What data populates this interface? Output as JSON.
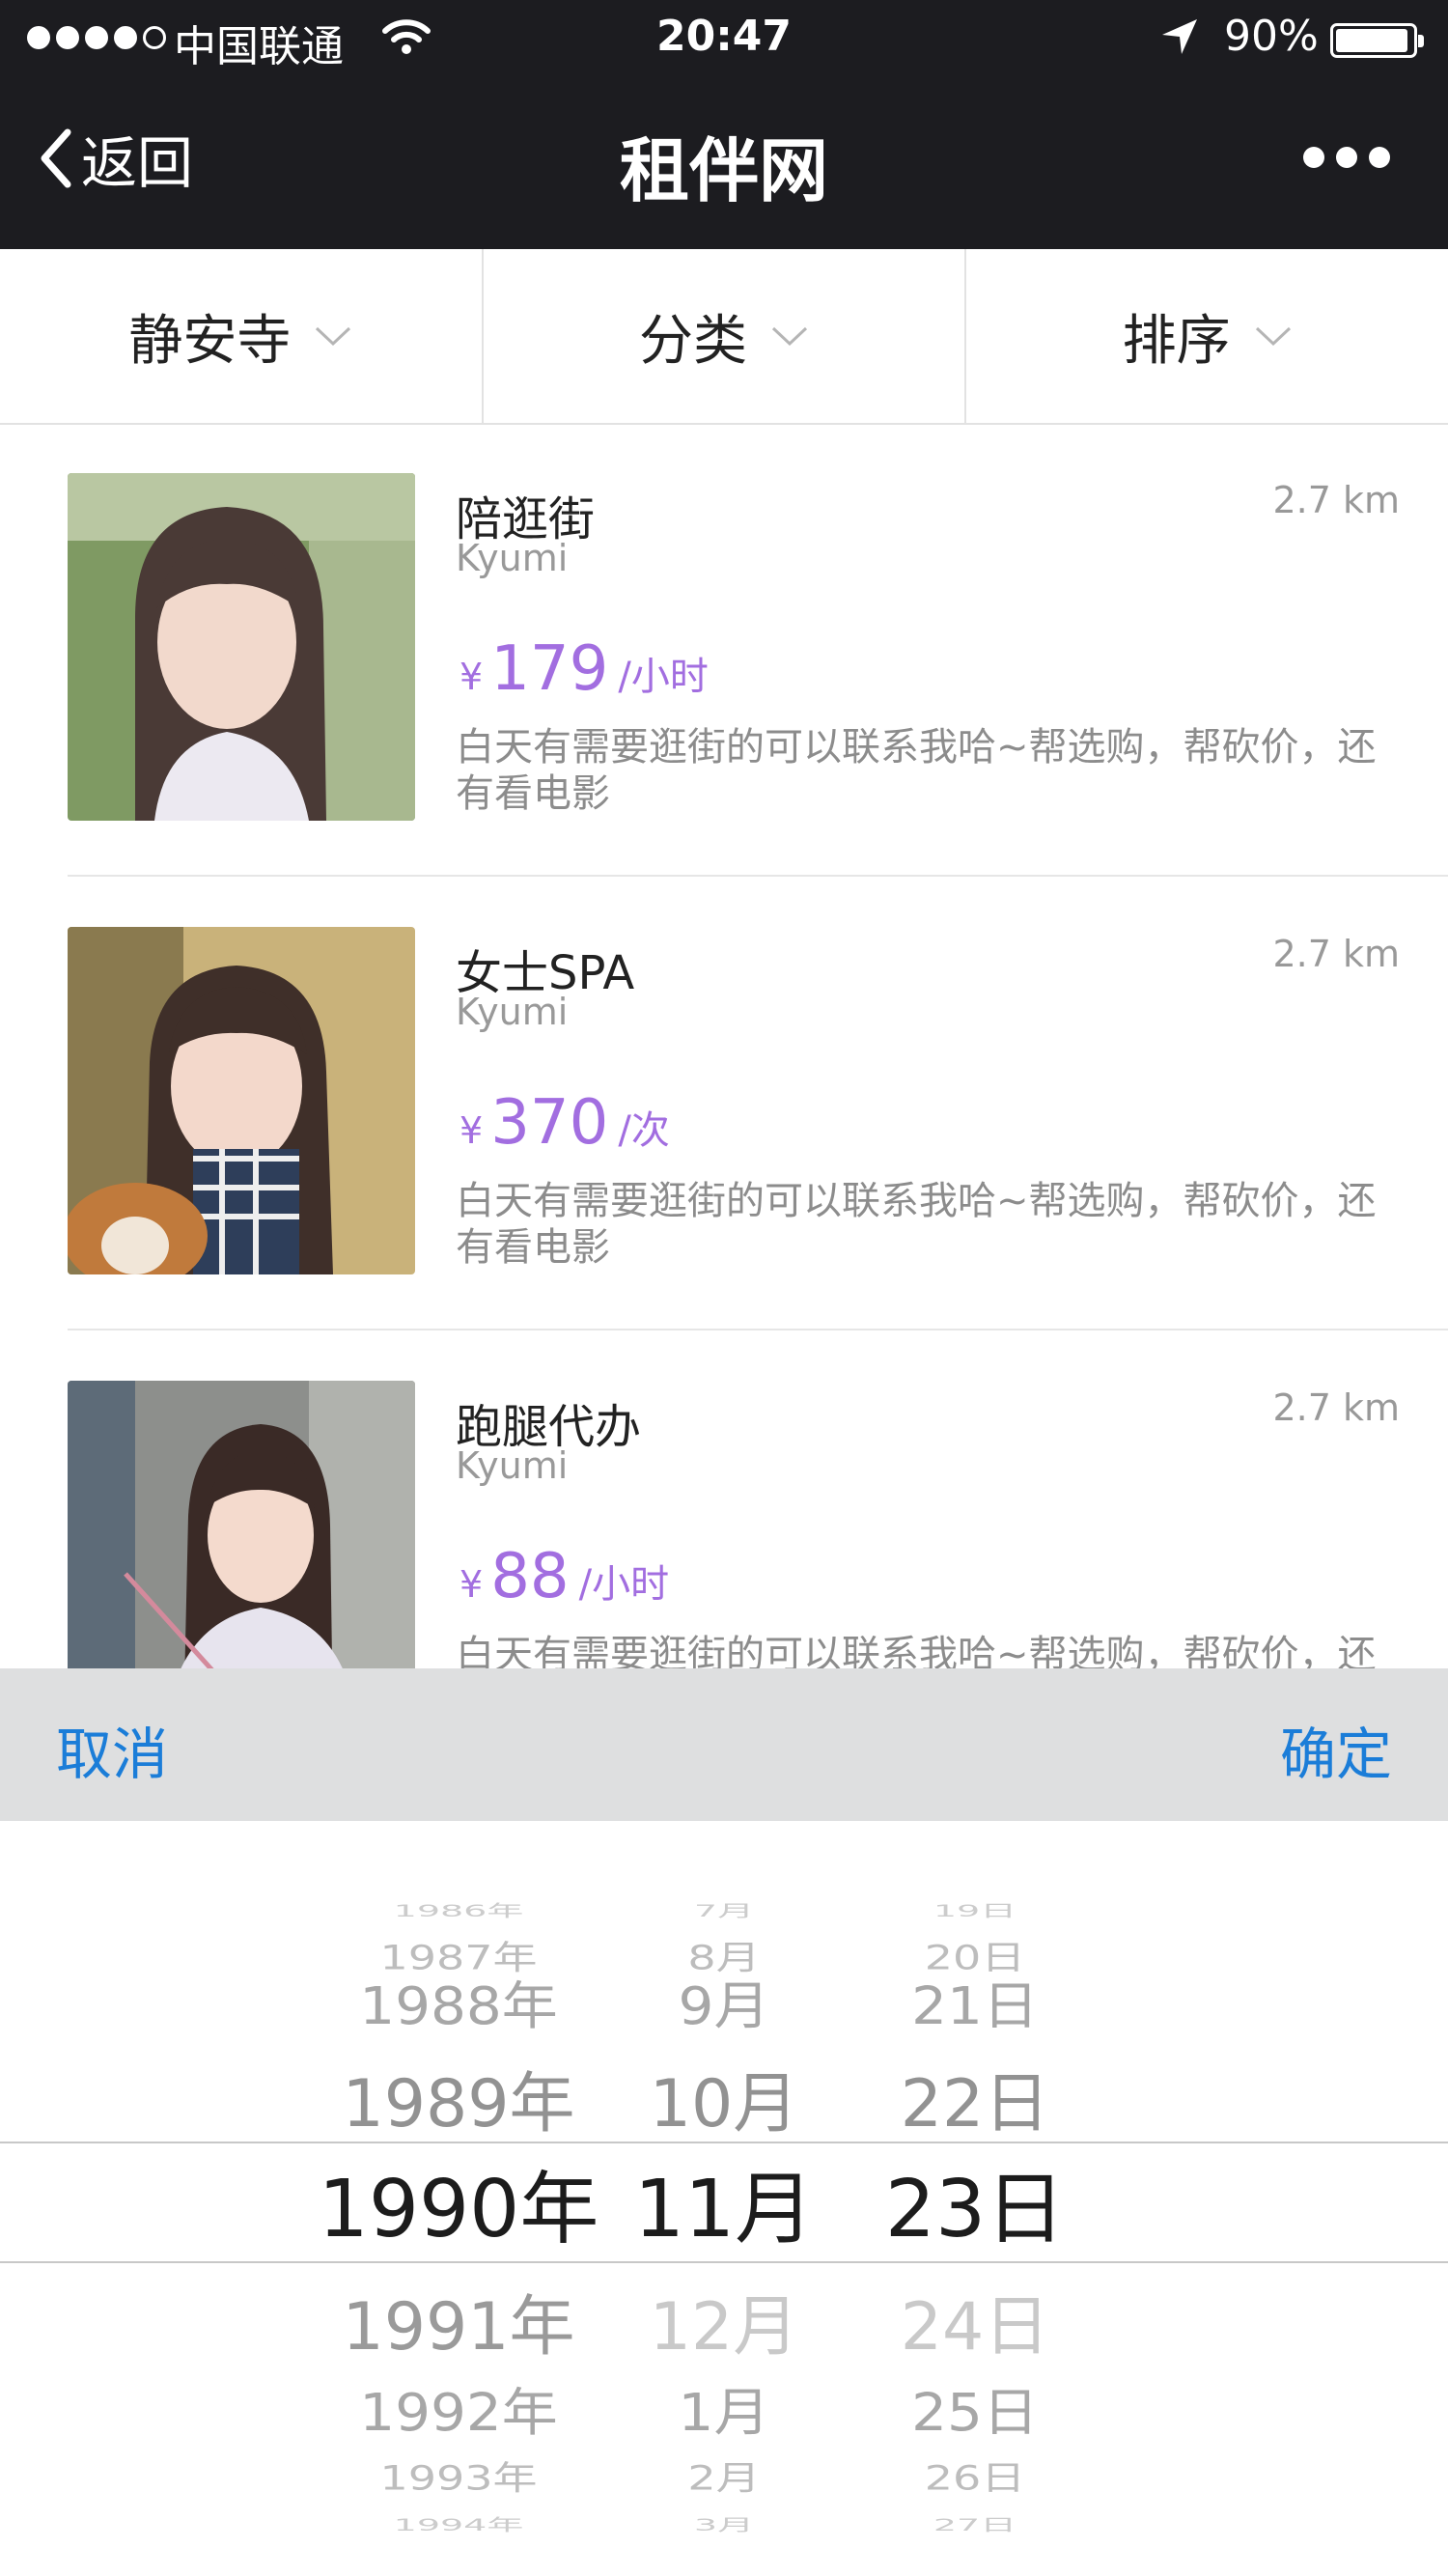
{
  "status_bar": {
    "carrier": "中国联通",
    "time": "20:47",
    "battery": "90%",
    "battery_level": 0.9
  },
  "nav": {
    "back_label": "返回",
    "title": "租伴网"
  },
  "filters": [
    {
      "label": "静安寺"
    },
    {
      "label": "分类"
    },
    {
      "label": "排序"
    }
  ],
  "listings": [
    {
      "title": "陪逛街",
      "user": "Kyumi",
      "distance": "2.7 km",
      "currency": "¥",
      "price": "179",
      "unit": "/小时",
      "description": "白天有需要逛街的可以联系我哈~帮选购，帮砍价，还有看电影"
    },
    {
      "title": "女士SPA",
      "user": "Kyumi",
      "distance": "2.7 km",
      "currency": "¥",
      "price": "370",
      "unit": "/次",
      "description": "白天有需要逛街的可以联系我哈~帮选购，帮砍价，还有看电影"
    },
    {
      "title": "跑腿代办",
      "user": "Kyumi",
      "distance": "2.7 km",
      "currency": "¥",
      "price": "88",
      "unit": "/小时",
      "description": "白天有需要逛街的可以联系我哈~帮选购，帮砍价，还有看电影"
    }
  ],
  "picker": {
    "cancel_label": "取消",
    "confirm_label": "确定",
    "years": [
      "1986年",
      "1987年",
      "1988年",
      "1989年",
      "1990年",
      "1991年",
      "1992年",
      "1993年",
      "1994年"
    ],
    "months": [
      "7月",
      "8月",
      "9月",
      "10月",
      "11月",
      "12月",
      "1月",
      "2月",
      "3月"
    ],
    "days": [
      "19日",
      "20日",
      "21日",
      "22日",
      "23日",
      "24日",
      "25日",
      "26日",
      "27日"
    ],
    "selected": {
      "year": "1990年",
      "month": "11月",
      "day": "23日"
    }
  },
  "colors": {
    "nav_background": "#1c1c20",
    "price_purple": "#a26ee0",
    "action_blue": "#1b7dd8",
    "picker_bar": "#dedfe0"
  }
}
